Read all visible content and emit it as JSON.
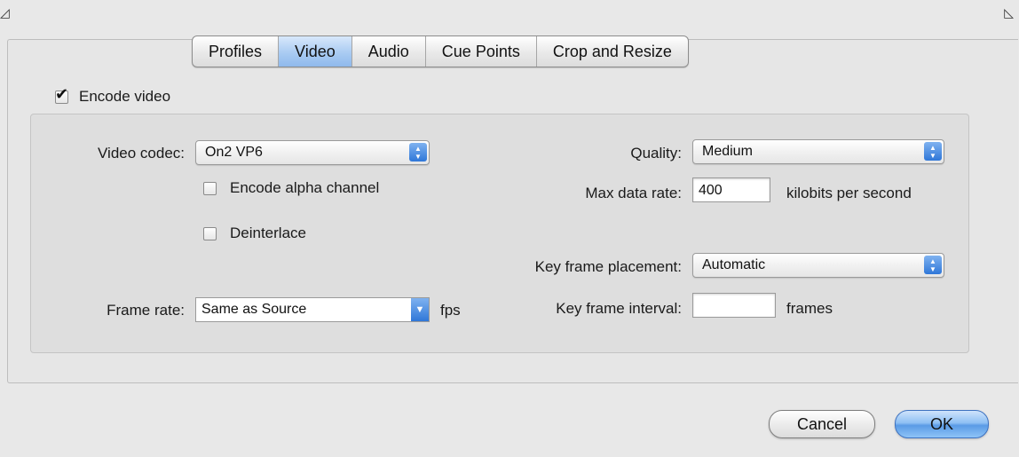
{
  "window": {
    "corner_left_glyph": "◿",
    "corner_right_glyph": "◺"
  },
  "tabs": [
    {
      "label": "Profiles",
      "selected": false
    },
    {
      "label": "Video",
      "selected": true
    },
    {
      "label": "Audio",
      "selected": false
    },
    {
      "label": "Cue Points",
      "selected": false
    },
    {
      "label": "Crop and Resize",
      "selected": false
    }
  ],
  "encode_video": {
    "label": "Encode video",
    "checked": true
  },
  "video_codec": {
    "label": "Video codec:",
    "value": "On2 VP6"
  },
  "encode_alpha": {
    "label": "Encode alpha channel",
    "checked": false
  },
  "deinterlace": {
    "label": "Deinterlace",
    "checked": false
  },
  "frame_rate": {
    "label": "Frame rate:",
    "value": "Same as Source",
    "unit": "fps"
  },
  "quality": {
    "label": "Quality:",
    "value": "Medium"
  },
  "max_data_rate": {
    "label": "Max data rate:",
    "value": "400",
    "unit": "kilobits per second"
  },
  "key_frame_placement": {
    "label": "Key frame placement:",
    "value": "Automatic"
  },
  "key_frame_interval": {
    "label": "Key frame interval:",
    "value": "",
    "unit": "frames"
  },
  "buttons": {
    "cancel": "Cancel",
    "ok": "OK"
  },
  "colors": {
    "selected_tab": "#a9cbf2",
    "accent_blue": "#2f77d8"
  }
}
